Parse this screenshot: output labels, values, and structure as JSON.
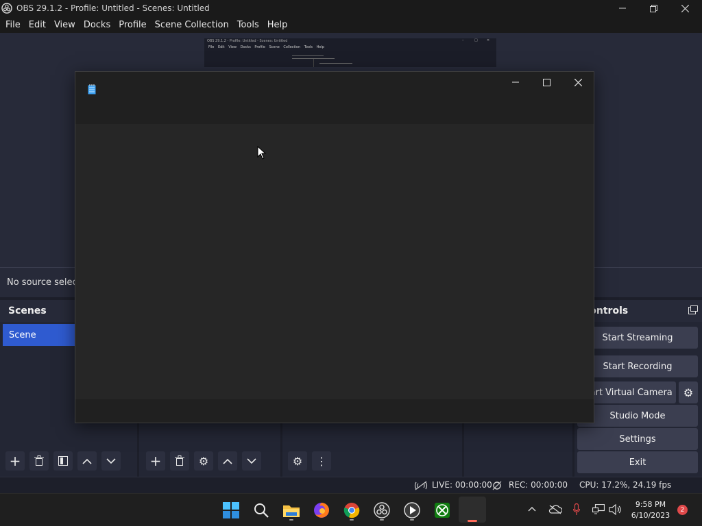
{
  "window": {
    "title": "OBS 29.1.2 - Profile: Untitled - Scenes: Untitled"
  },
  "menu": [
    "File",
    "Edit",
    "View",
    "Docks",
    "Profile",
    "Scene Collection",
    "Tools",
    "Help"
  ],
  "preview": {
    "mini_title": "OBS 29.1.2 - Profile: Untitled - Scenes: Untitled",
    "mini_menu": "File Edit View Docks Profile Scene Collection Tools Help"
  },
  "source_bar": {
    "text": "No source selected"
  },
  "scenes": {
    "header": "Scenes",
    "items": [
      "Scene"
    ]
  },
  "controls": {
    "header": "Controls",
    "buttons": {
      "start_streaming": "Start Streaming",
      "start_recording": "Start Recording",
      "start_virtual_camera": "Start Virtual Camera",
      "studio_mode": "Studio Mode",
      "settings": "Settings",
      "exit": "Exit"
    }
  },
  "status": {
    "live": "LIVE: 00:00:00",
    "rec": "REC: 00:00:00",
    "cpu": "CPU: 17.2%, 24.19 fps"
  },
  "taskbar": {
    "time": "9:58 PM",
    "date": "6/10/2023",
    "notifications": "2"
  },
  "colors": {
    "accent": "#2f5bd0",
    "panel": "#232634",
    "preview": "#272a39"
  }
}
